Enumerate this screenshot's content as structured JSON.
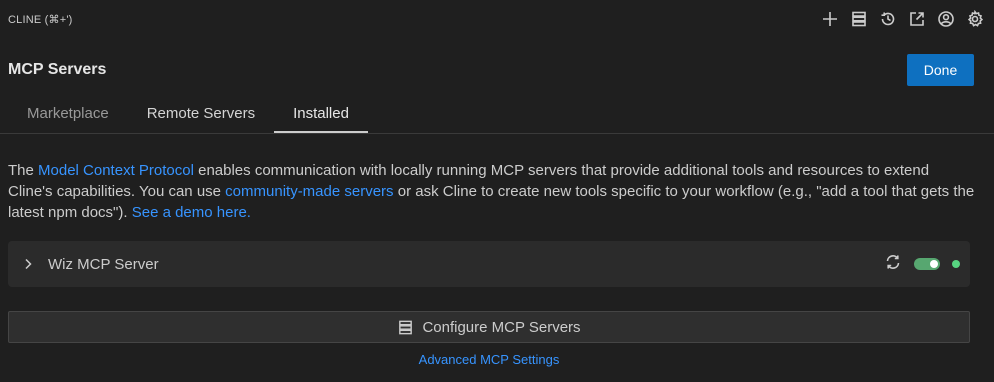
{
  "app": {
    "title": "CLINE (⌘+')"
  },
  "toolbar_icons": [
    "plus-icon",
    "server-stack-icon",
    "history-icon",
    "open-external-icon",
    "account-icon",
    "settings-gear-icon"
  ],
  "header": {
    "title": "MCP Servers",
    "done_label": "Done"
  },
  "tabs": [
    {
      "label": "Marketplace"
    },
    {
      "label": "Remote Servers"
    },
    {
      "label": "Installed",
      "active": true
    }
  ],
  "description": {
    "p1": "The ",
    "link1": "Model Context Protocol",
    "p2": " enables communication with locally running MCP servers that provide additional tools and resources to extend Cline's capabilities. You can use ",
    "link2": "community-made servers",
    "p3": " or ask Cline to create new tools specific to your workflow (e.g., \"add a tool that gets the latest npm docs\"). ",
    "link3": "See a demo here."
  },
  "servers": [
    {
      "name": "Wiz MCP Server",
      "enabled": true,
      "status_color": "#57d581"
    }
  ],
  "configure_button": {
    "label": "Configure MCP Servers"
  },
  "advanced_link": "Advanced MCP Settings",
  "colors": {
    "accent": "#0e70c0",
    "link": "#3794ff",
    "toggle_on": "#57a770"
  }
}
